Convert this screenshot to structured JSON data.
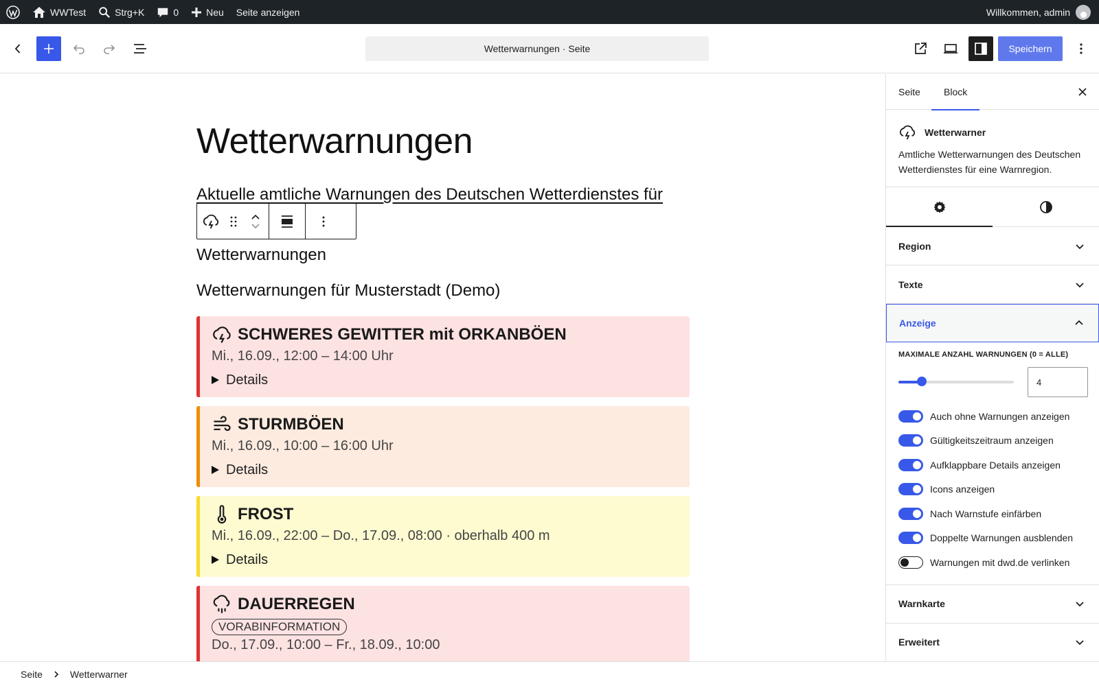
{
  "adminbar": {
    "site_name": "WWTest",
    "search_shortcut": "Strg+K",
    "comments_count": "0",
    "new_label": "Neu",
    "view_page": "Seite anzeigen",
    "greeting": "Willkommen, admin"
  },
  "header": {
    "document_title": "Wetterwarnungen · Seite",
    "save_label": "Speichern"
  },
  "content": {
    "page_title": "Wetterwarnungen",
    "intro": "Aktuelle amtliche Warnungen des Deutschen Wetterdienstes für",
    "block_heading": "Wetterwarnungen",
    "region_title": "Wetterwarnungen für Musterstadt (Demo)",
    "warnings": [
      {
        "title": "SCHWERES GEWITTER mit ORKANBÖEN",
        "time": "Mi., 16.09., 12:00 – 14:00 Uhr",
        "details": "Details",
        "icon": "thunderstorm-icon",
        "color": "#e03131"
      },
      {
        "title": "STURMBÖEN",
        "time": "Mi., 16.09., 10:00 – 16:00 Uhr",
        "details": "Details",
        "icon": "wind-icon",
        "color": "#f08c00"
      },
      {
        "title": "FROST",
        "time": "Mi., 16.09., 22:00 – Do., 17.09., 08:00 · oberhalb 400 m",
        "details": "Details",
        "icon": "thermometer-icon",
        "color": "#fcd92b"
      },
      {
        "title": "DAUERREGEN",
        "badge": "VORABINFORMATION",
        "time": "Do., 17.09., 10:00 – Fr., 18.09., 10:00",
        "icon": "rain-icon",
        "color": "#e03131"
      }
    ]
  },
  "sidebar": {
    "tabs": [
      "Seite",
      "Block"
    ],
    "active_tab": "Block",
    "block_name": "Wetterwarner",
    "block_description": "Amtliche Wetterwarnungen des Deutschen Wetterdienstes für eine Warnregion.",
    "panels": {
      "region": "Region",
      "texts": "Texte",
      "display": "Anzeige",
      "map": "Warnkarte",
      "advanced": "Erweitert"
    },
    "max_label": "Maximale Anzahl Warnungen (0 = alle)",
    "max_value": "4",
    "max_fraction": 0.2,
    "toggles": [
      {
        "label": "Auch ohne Warnungen anzeigen",
        "on": true
      },
      {
        "label": "Gültigkeitszeitraum anzeigen",
        "on": true
      },
      {
        "label": "Aufklappbare Details anzeigen",
        "on": true
      },
      {
        "label": "Icons anzeigen",
        "on": true
      },
      {
        "label": "Nach Warnstufe einfärben",
        "on": true
      },
      {
        "label": "Doppelte Warnungen ausblenden",
        "on": true
      },
      {
        "label": "Warnungen mit dwd.de verlinken",
        "on": false
      }
    ]
  },
  "footer": {
    "crumbs": [
      "Seite",
      "Wetterwarner"
    ]
  },
  "colors": {
    "accent": "#3858e9",
    "adminbar": "#1d2327"
  }
}
